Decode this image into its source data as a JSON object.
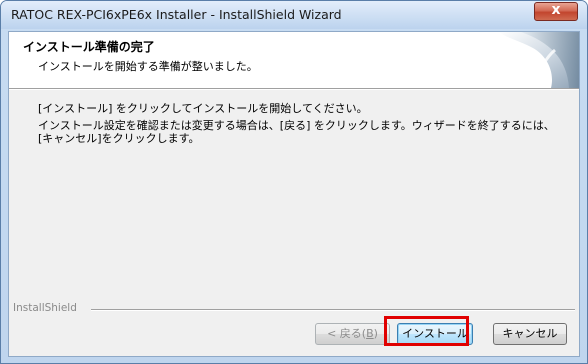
{
  "window": {
    "title": "RATOC REX-PCI6xPE6x Installer - InstallShield Wizard",
    "close_label": "x"
  },
  "header": {
    "title": "インストール準備の完了",
    "subtitle": "インストールを開始する準備が整いました。"
  },
  "body": {
    "line1": "[インストール] をクリックしてインストールを開始してください。",
    "line2": "インストール設定を確認または変更する場合は、[戻る] をクリックします。ウィザードを終了するには、[キャンセル]をクリックします。"
  },
  "footer": {
    "brand": "InstallShield"
  },
  "buttons": {
    "back_prefix": "< 戻る(",
    "back_key": "B",
    "back_suffix": ")",
    "install": "インストール",
    "cancel": "キャンセル"
  },
  "colors": {
    "highlight": "#e00000",
    "install_button_border": "#3c7fb1"
  }
}
